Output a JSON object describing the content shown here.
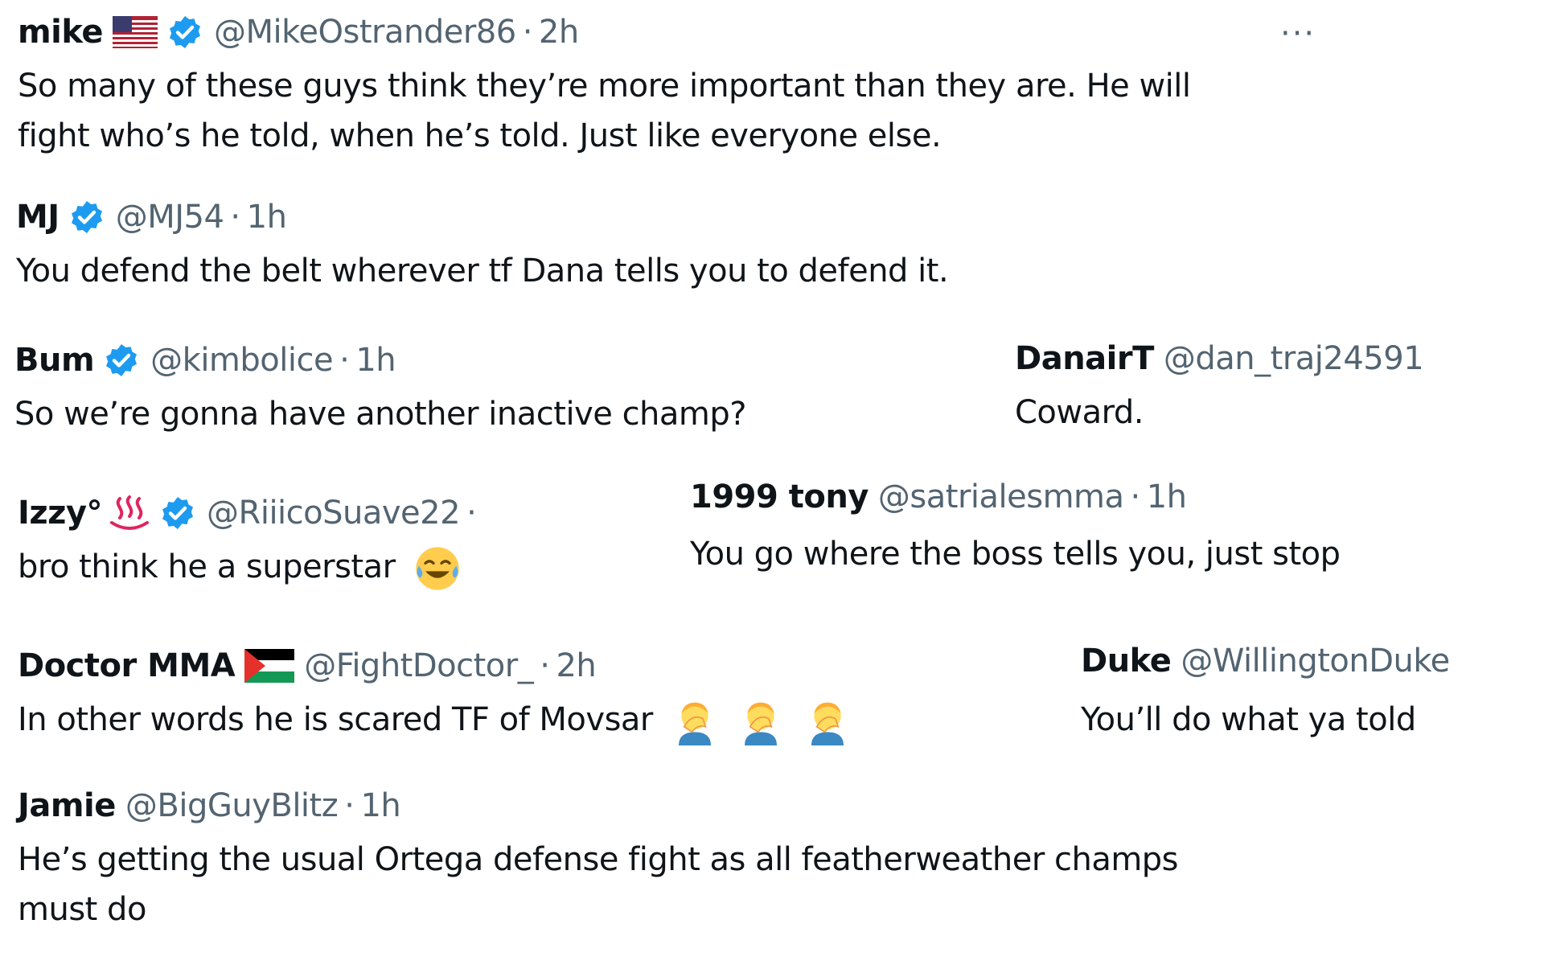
{
  "more_label": "···",
  "accent": {
    "verified": "#1d9bf0",
    "handle": "#536471"
  },
  "tweets": {
    "mike": {
      "name": "mike",
      "flag_icon": "us-flag-icon",
      "verified": true,
      "handle": "@MikeOstrander86",
      "sep": "·",
      "time": "2h",
      "lines": [
        "So many of these guys think they’re more important than they are. He will",
        "fight who’s he told, when he’s told. Just like everyone else."
      ]
    },
    "mj": {
      "name": "MJ",
      "verified": true,
      "handle": "@MJ54",
      "sep": "·",
      "time": "1h",
      "lines": [
        "You defend the belt wherever tf Dana tells you to defend it."
      ]
    },
    "bum": {
      "name": "Bum",
      "verified": true,
      "handle": "@kimbolice",
      "sep": "·",
      "time": "1h",
      "lines": [
        "So we’re gonna have another inactive champ?"
      ]
    },
    "danair": {
      "name": "DanairT",
      "handle": "@dan_traj24591",
      "lines": [
        "Coward."
      ]
    },
    "izzy": {
      "name": "Izzy°",
      "name_icon": "hot-springs-icon",
      "verified": true,
      "handle": "@RiiicoSuave22",
      "sep": "·",
      "lines": [
        "bro think he a superstar"
      ],
      "emoji_icon": "tears-of-joy-emoji-icon"
    },
    "tony": {
      "name": "1999 tony",
      "handle": "@satrialesmma",
      "sep": "·",
      "time": "1h",
      "lines": [
        "You go where the boss tells you, just stop"
      ]
    },
    "doctor": {
      "name": "Doctor MMA",
      "flag_icon": "palestine-flag-icon",
      "handle": "@FightDoctor_",
      "sep": "·",
      "time": "2h",
      "lines": [
        "In other words he is scared TF of Movsar"
      ],
      "emoji_icon": "facepalm-emoji-icon"
    },
    "duke": {
      "name": "Duke",
      "handle": "@WillingtonDuke",
      "lines": [
        "You’ll do what ya told"
      ]
    },
    "jamie": {
      "name": "Jamie",
      "handle": "@BigGuyBlitz",
      "sep": "·",
      "time": "1h",
      "lines": [
        "He’s getting the usual Ortega defense fight as all featherweather champs",
        "must do"
      ]
    }
  }
}
